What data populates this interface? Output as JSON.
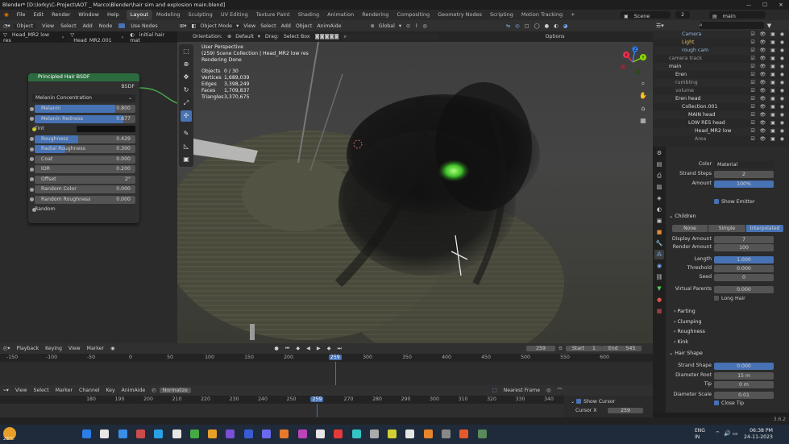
{
  "window": {
    "title": "Blender* [D:\\lorky\\C-Project\\AOT _ Marco\\Blender\\hair sim and explosion main.blend]"
  },
  "menu": {
    "items": [
      "File",
      "Edit",
      "Render",
      "Window",
      "Help"
    ],
    "workspaces": [
      "Layout",
      "Modeling",
      "Sculpting",
      "UV Editing",
      "Texture Paint",
      "Shading",
      "Animation",
      "Rendering",
      "Compositing",
      "Geometry Nodes",
      "Scripting",
      "Motion Tracking"
    ],
    "active_workspace": "Layout",
    "add_tab": "+",
    "scene_label": "Scene",
    "scene_users": "2",
    "view_layer": "main"
  },
  "node_editor": {
    "header": {
      "type": "Object",
      "menus": [
        "View",
        "Select",
        "Add",
        "Node"
      ],
      "use_nodes": "Use Nodes"
    },
    "breadcrumb": [
      "Head_MR2 low res",
      "Head_MR2.001",
      "initial hair mat"
    ],
    "node": {
      "title": "Principled Hair BSDF",
      "output": "BSDF",
      "parametrization": "Melanin Concentration",
      "fields": [
        {
          "label": "Melanin",
          "value": "0.800",
          "fill": 0.8
        },
        {
          "label": "Melanin Redness",
          "value": "0.877",
          "fill": 0.877
        },
        {
          "label": "Roughness",
          "value": "0.429",
          "fill": 0.429
        },
        {
          "label": "Radial Roughness",
          "value": "0.300",
          "fill": 0.3
        },
        {
          "label": "Coat",
          "value": "0.000",
          "fill": 0
        },
        {
          "label": "IOR",
          "value": "0.200",
          "fill": 0
        },
        {
          "label": "Offset",
          "value": "2°",
          "fill": 0
        },
        {
          "label": "Random Color",
          "value": "0.000",
          "fill": 0
        },
        {
          "label": "Random Roughness",
          "value": "0.000",
          "fill": 0
        }
      ],
      "tint_label": "Tint",
      "random_label": "Random"
    }
  },
  "viewport": {
    "header": {
      "mode": "Object Mode",
      "menus": [
        "View",
        "Select",
        "Add",
        "Object",
        "AnimAide"
      ],
      "transform": "Global",
      "options": "Options"
    },
    "header2": {
      "orientation_label": "Orientation:",
      "orientation": "Default",
      "drag_label": "Drag:",
      "drag": "Select Box"
    },
    "overlay": {
      "view_name": "User Perspective",
      "collection": "(259) Scene Collection | Head_MR2 low res",
      "status": "Rendering Done",
      "stats": [
        {
          "k": "Objects",
          "v": "0 / 30"
        },
        {
          "k": "Vertices",
          "v": "1,689,039"
        },
        {
          "k": "Edges",
          "v": "3,398,249"
        },
        {
          "k": "Faces",
          "v": "1,709,837"
        },
        {
          "k": "Triangles",
          "v": "3,370,675"
        }
      ]
    },
    "gizmo": {
      "x": "X",
      "y": "Y",
      "z": "Z"
    }
  },
  "outliner": {
    "rows": [
      {
        "name": "Camera",
        "indent": 3,
        "color": "#8fb3d9"
      },
      {
        "name": "Light",
        "indent": 3,
        "color": "#e0c060"
      },
      {
        "name": "rough cam",
        "indent": 3,
        "color": "#8fb3d9"
      },
      {
        "name": "camera track",
        "indent": 1,
        "color": "#9a9a9a"
      },
      {
        "name": "main",
        "indent": 1,
        "color": "#dddddd"
      },
      {
        "name": "Eren",
        "indent": 2,
        "color": "#dddddd"
      },
      {
        "name": "rumbling",
        "indent": 2,
        "color": "#9a9a9a"
      },
      {
        "name": "volume",
        "indent": 2,
        "color": "#9a9a9a"
      },
      {
        "name": "Eren head",
        "indent": 2,
        "color": "#dddddd"
      },
      {
        "name": "Collection.001",
        "indent": 3,
        "color": "#dddddd"
      },
      {
        "name": "MAIN head",
        "indent": 4,
        "color": "#dddddd"
      },
      {
        "name": "LOW RES head",
        "indent": 4,
        "color": "#dddddd"
      },
      {
        "name": "Head_MR2 low",
        "indent": 5,
        "color": "#dddddd"
      },
      {
        "name": "Area",
        "indent": 5,
        "color": "#9a9a9a"
      }
    ],
    "visibility_icons": "☑ 👁 ▣ ◉"
  },
  "properties": {
    "render": {
      "color_label": "Color",
      "color": "Material",
      "strand_steps_label": "Strand Steps",
      "strand_steps": "2",
      "amount_label": "Amount",
      "amount": "100%",
      "show_emitter": "Show Emitter"
    },
    "children": {
      "title": "Children",
      "modes": [
        "None",
        "Simple",
        "Interpolated"
      ],
      "active_mode": "Interpolated",
      "display_amount_label": "Display Amount",
      "display_amount": "7",
      "render_amount_label": "Render Amount",
      "render_amount": "100",
      "length_label": "Length",
      "length": "1.000",
      "threshold_label": "Threshold",
      "threshold": "0.000",
      "seed_label": "Seed",
      "seed": "0",
      "virtual_parents_label": "Virtual Parents",
      "virtual_parents": "0.000",
      "long_hair": "Long Hair"
    },
    "subpanels": [
      "Parting",
      "Clumping",
      "Roughness",
      "Kink"
    ],
    "hair_shape": {
      "title": "Hair Shape",
      "strand_shape_label": "Strand Shape",
      "strand_shape": "0.000",
      "diameter_root_label": "Diameter Root",
      "diameter_root": "15 m",
      "tip_label": "Tip",
      "tip": "0 m",
      "diameter_scale_label": "Diameter Scale",
      "diameter_scale": "0.01",
      "close_tip": "Close Tip"
    },
    "version": "3.6.2"
  },
  "timeline": {
    "header": {
      "menus": [
        "Playback",
        "Keying",
        "View",
        "Marker"
      ]
    },
    "current_frame": "259",
    "start_label": "Start",
    "start": "1",
    "end_label": "End",
    "end": "545",
    "ruler_ticks": [
      "-150",
      "-100",
      "-50",
      "0",
      "50",
      "100",
      "150",
      "200",
      "259",
      "300",
      "350",
      "400",
      "450",
      "500",
      "550",
      "600"
    ]
  },
  "graph_editor": {
    "header": {
      "menus": [
        "View",
        "Select",
        "Marker",
        "Channel",
        "Key",
        "AnimAide"
      ],
      "normalize": "Normalize",
      "snapping": "Nearest Frame"
    },
    "ruler_ticks": [
      "180",
      "190",
      "200",
      "210",
      "220",
      "230",
      "240",
      "250",
      "259",
      "270",
      "280",
      "290",
      "300",
      "310",
      "320",
      "330",
      "340"
    ],
    "side": {
      "show_cursor": "Show Cursor",
      "cursor_x_label": "Cursor X",
      "cursor_x": "259"
    }
  },
  "taskbar": {
    "weather_temp": "28°C",
    "lang1": "ENG",
    "lang2": "IN",
    "time": "06:38 PM",
    "date": "24-11-2023",
    "icon_colors": [
      "#2a7ee6",
      "#e6e6e6",
      "#3a8ee6",
      "#cc4b4b",
      "#2aa0e6",
      "#e6e6e6",
      "#44aa44",
      "#e6a02a",
      "#7b4fd6",
      "#3a5bd6",
      "#6a6aee",
      "#e67a2a",
      "#bb44bb",
      "#e6e6e6",
      "#e63a3a",
      "#33c4c4",
      "#aaaaaa",
      "#d0d033",
      "#e6e6e6",
      "#e6852a",
      "#888888",
      "#e65a2a",
      "#5a8a5a"
    ]
  }
}
